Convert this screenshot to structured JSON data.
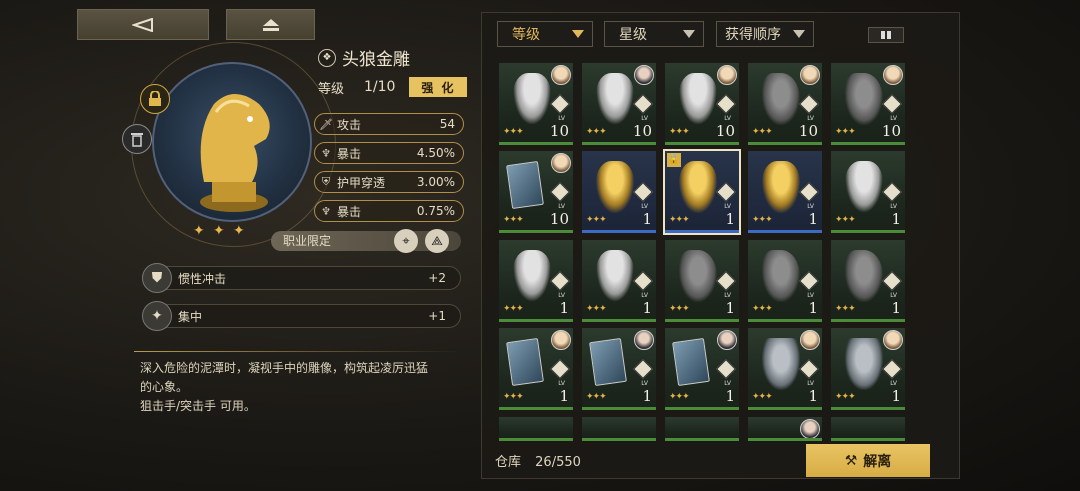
{
  "nav": {
    "back_icon": "back-arrow-icon",
    "home_icon": "eject-icon"
  },
  "item": {
    "name": "头狼金雕",
    "level_label": "等级",
    "level_value": "1/10",
    "enhance_label": "强 化",
    "stats": [
      {
        "name": "攻击",
        "value": "54",
        "icon": "sword-icon"
      },
      {
        "name": "暴击",
        "value": "4.50%",
        "icon": "crit-icon"
      },
      {
        "name": "护甲穿透",
        "value": "3.00%",
        "icon": "armor-pierce-icon"
      },
      {
        "name": "暴击",
        "value": "0.75%",
        "icon": "crit-icon"
      }
    ],
    "class_limit_label": "职业限定",
    "skills": [
      {
        "name": "惯性冲击",
        "value": "+2",
        "icon": "shield-skill-icon"
      },
      {
        "name": "集中",
        "value": "+1",
        "icon": "sparkle-skill-icon"
      }
    ],
    "description_line1": "深入危险的泥潭时，凝视手中的雕像，构筑起凌厉迅猛",
    "description_line2": "的心象。",
    "description_line3": "狙击手/突击手 可用。"
  },
  "filters": {
    "level": "等级",
    "star": "星级",
    "order": "获得顺序"
  },
  "inventory": {
    "cards": [
      [
        "10",
        "10",
        "10",
        "10",
        "10"
      ],
      [
        "10",
        "1",
        "1",
        "1",
        "1"
      ],
      [
        "1",
        "1",
        "1",
        "1",
        "1"
      ],
      [
        "1",
        "1",
        "1",
        "1",
        "1"
      ]
    ],
    "lv_label": "LV",
    "storage_label": "仓库",
    "storage_count": "26/550",
    "dismantle_label": "解离"
  }
}
